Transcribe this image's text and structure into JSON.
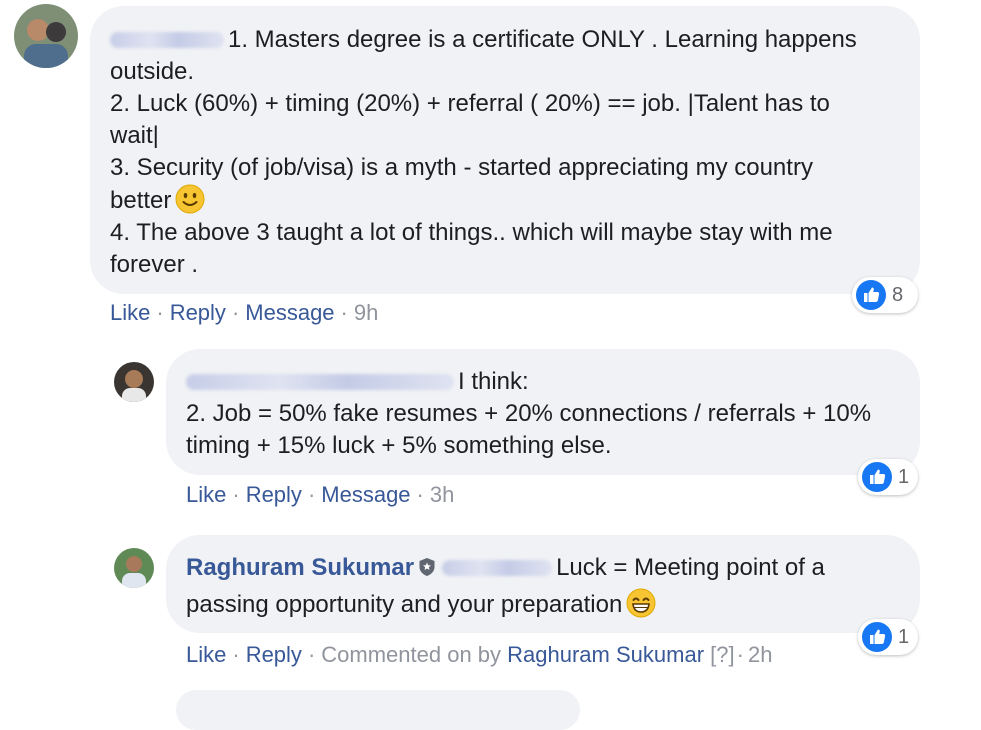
{
  "comments": [
    {
      "text_lines": [
        "1. Masters degree is a certificate ONLY . Learning happens",
        "outside.",
        "2. Luck (60%) + timing (20%) + referral ( 20%) == job. |Talent has to",
        "wait|",
        "3. Security (of job/visa) is a myth - started appreciating my country",
        "better",
        "4. The above 3 taught a lot of things.. which will maybe stay with me",
        "forever ."
      ],
      "emoji": "slightly-smiling-face",
      "reaction_count": "8",
      "actions": {
        "like": "Like",
        "reply": "Reply",
        "message": "Message",
        "time": "9h"
      }
    },
    {
      "text_lines": [
        "I think:",
        "2. Job = 50% fake resumes + 20% connections / referrals + 10%",
        "timing + 15% luck + 5% something else."
      ],
      "reaction_count": "1",
      "actions": {
        "like": "Like",
        "reply": "Reply",
        "message": "Message",
        "time": "3h"
      }
    },
    {
      "author": "Raghuram Sukumar",
      "text_lines": [
        "Luck = Meeting point of a",
        "passing opportunity and your preparation"
      ],
      "emoji": "grinning-face",
      "reaction_count": "1",
      "actions": {
        "like": "Like",
        "reply": "Reply",
        "commented_on_by": "Commented on by",
        "commenter": "Raghuram Sukumar",
        "help": "[?]",
        "time": "2h"
      }
    }
  ],
  "colors": {
    "link": "#385898",
    "bubble": "#f0f2f5",
    "meta": "#90949c",
    "like_blue": "#1877f2"
  }
}
